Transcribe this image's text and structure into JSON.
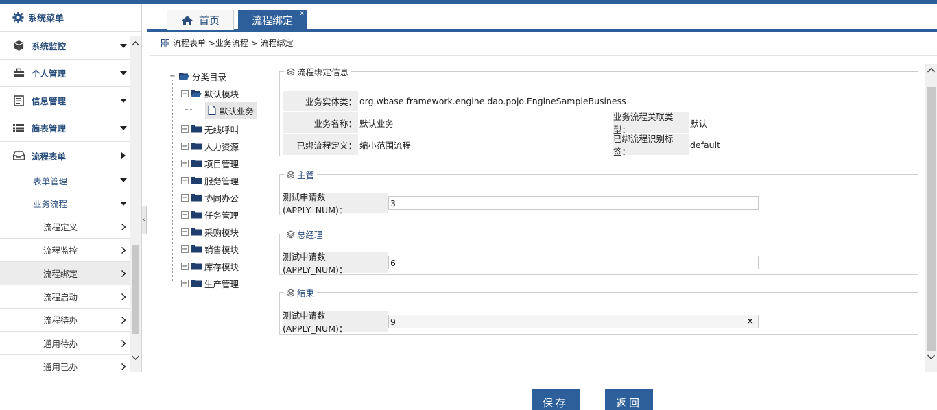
{
  "sidebar": {
    "title": "系统菜单",
    "items": [
      {
        "label": "系统监控",
        "icon": "cube-icon"
      },
      {
        "label": "个人管理",
        "icon": "briefcase-icon"
      },
      {
        "label": "信息管理",
        "icon": "document-icon"
      },
      {
        "label": "简表管理",
        "icon": "list-icon"
      },
      {
        "label": "流程表单",
        "icon": "inbox-icon"
      }
    ],
    "sub": [
      {
        "label": "表单管理"
      },
      {
        "label": "业务流程"
      }
    ],
    "leaves": [
      {
        "label": "流程定义"
      },
      {
        "label": "流程监控"
      },
      {
        "label": "流程绑定"
      },
      {
        "label": "流程启动"
      },
      {
        "label": "流程待办"
      },
      {
        "label": "通用待办"
      },
      {
        "label": "通用已办"
      }
    ]
  },
  "tabs": {
    "home": "首页",
    "active": "流程绑定",
    "close": "x"
  },
  "breadcrumb": "流程表单 >业务流程 > 流程绑定",
  "tree": {
    "root": "分类目录",
    "default_module": "默认模块",
    "default_business": "默认业务",
    "nodes": [
      "无线呼叫",
      "人力资源",
      "项目管理",
      "服务管理",
      "协同办公",
      "任务管理",
      "采购模块",
      "销售模块",
      "库存模块",
      "生产管理"
    ]
  },
  "binding": {
    "legend": "流程绑定信息",
    "entity_label": "业务实体类：",
    "entity_value": "org.wbase.framework.engine.dao.pojo.EngineSampleBusiness",
    "name_label": "业务名称：",
    "name_value": "默认业务",
    "relation_label": "业务流程关联类型：",
    "relation_value": "默认",
    "flow_label": "已绑流程定义：",
    "flow_value": "缩小范围流程",
    "tag_label": "已绑流程识别标签：",
    "tag_value": "default"
  },
  "sections": [
    {
      "legend": "主管",
      "field_label": "测试申请数(APPLY_NUM)：",
      "value": "3"
    },
    {
      "legend": "总经理",
      "field_label": "测试申请数(APPLY_NUM)：",
      "value": "6"
    },
    {
      "legend": "结束",
      "field_label": "测试申请数(APPLY_NUM)：",
      "value": "9"
    }
  ],
  "buttons": {
    "save": "保存",
    "back": "返回"
  },
  "colors": {
    "primary": "#2d5f9a",
    "menu_text": "#2a4f7d"
  }
}
